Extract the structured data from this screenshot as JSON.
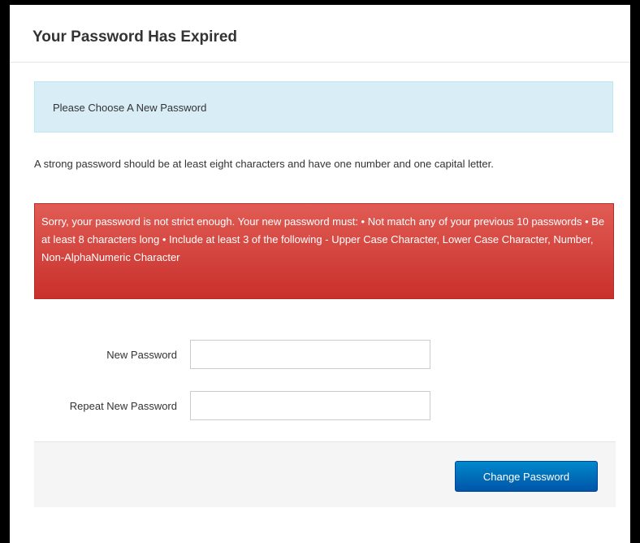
{
  "dialog": {
    "title": "Your Password Has Expired"
  },
  "info": {
    "message": "Please Choose A New Password"
  },
  "help": {
    "text": "A strong password should be at least eight characters and have one number and one capital letter."
  },
  "error": {
    "message": "Sorry, your password is not strict enough. Your new password must: • Not match any of your previous 10 passwords • Be at least 8 characters long • Include at least 3 of the following - Upper Case Character, Lower Case Character, Number, Non-AlphaNumeric Character"
  },
  "form": {
    "new_password_label": "New Password",
    "new_password_value": "",
    "repeat_password_label": "Repeat New Password",
    "repeat_password_value": ""
  },
  "actions": {
    "submit_label": "Change Password"
  },
  "colors": {
    "info_bg": "#d9edf7",
    "error_bg": "#d9534f",
    "button_bg": "#0074cc"
  }
}
